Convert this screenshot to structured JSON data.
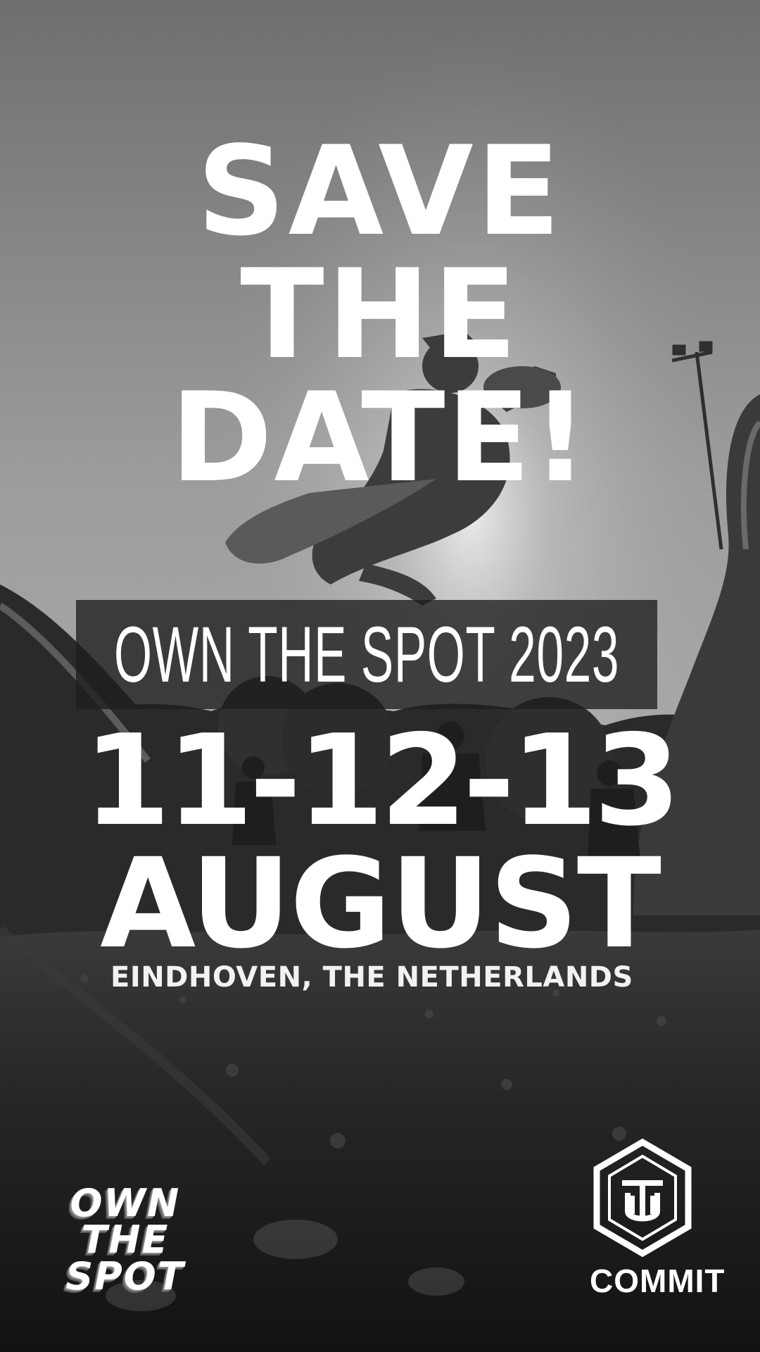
{
  "headline": {
    "line1": "SAVE",
    "line2": "THE",
    "line3": "DATE!"
  },
  "event_name": "OWN THE SPOT 2023",
  "dates": "11-12-13",
  "month": "AUGUST",
  "location": "EINDHOVEN, THE NETHERLANDS",
  "logos": {
    "own_the_spot": {
      "line1": "OWN",
      "line2": "THE",
      "line3": "SPOT"
    },
    "commit": "COMMIT"
  },
  "colors": {
    "text": "#ffffff",
    "band": "#1e1e1e",
    "sky": "#9a9a9a",
    "ground": "#1c1c1c"
  },
  "icons": {
    "commit_emblem": "hexagon-monogram-icon",
    "ots": "own-the-spot-wordmark"
  }
}
